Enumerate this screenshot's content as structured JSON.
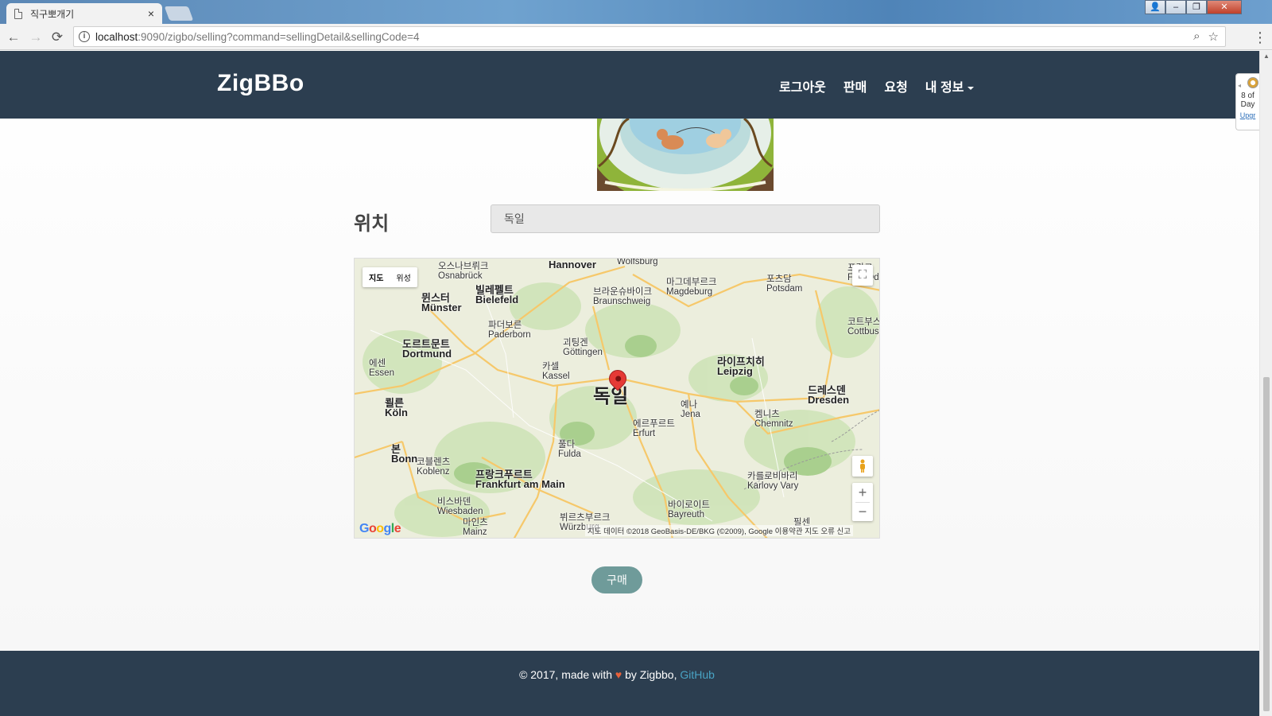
{
  "browser": {
    "tab_title": "직구뽀개기",
    "tab_close": "×",
    "url_host": "localhost",
    "url_rest": ":9090/zigbo/selling?command=sellingDetail&sellingCode=4",
    "back_icon": "←",
    "forward_icon": "→",
    "reload_icon": "⟳",
    "info_icon": "i",
    "zoom_icon": "⌕",
    "star_icon": "☆",
    "menu_icon": "⋮",
    "win_minimize": "–",
    "win_restore": "❐",
    "win_close": "✕",
    "win_user": "👤"
  },
  "extension": {
    "line1": "8 of",
    "line2": "Day",
    "link": "Upgr"
  },
  "navbar": {
    "brand": "ZigBBo",
    "links": [
      "로그아웃",
      "판매",
      "요청",
      "내 정보"
    ]
  },
  "location": {
    "label": "위치",
    "value": "독일"
  },
  "map": {
    "type_map": "지도",
    "type_satellite": "위성",
    "country_label": "독일",
    "zoom_in": "+",
    "zoom_out": "−",
    "fullscreen_icon": "⛶",
    "attribution": "지도 데이터 ©2018 GeoBasis-DE/BKG (©2009), Google   이용약관   지도 오류 신고",
    "google": "Google",
    "cities": [
      {
        "ko": "오스나브뤼크",
        "en": "Osnabrück"
      },
      {
        "ko": "",
        "en": "Hannover"
      },
      {
        "ko": "",
        "en": "Wolfsburg"
      },
      {
        "ko": "마그데부르크",
        "en": "Magdeburg"
      },
      {
        "ko": "포츠담",
        "en": "Potsdam"
      },
      {
        "ko": "프랑크",
        "en": "Fra (Oder)"
      },
      {
        "ko": "뮌스터",
        "en": "Münster"
      },
      {
        "ko": "빌레펠트",
        "en": "Bielefeld"
      },
      {
        "ko": "브라운슈바이크",
        "en": "Braunschweig"
      },
      {
        "ko": "파더보른",
        "en": "Paderborn"
      },
      {
        "ko": "코트부스",
        "en": "Cottbus"
      },
      {
        "ko": "도르트문트",
        "en": "Dortmund"
      },
      {
        "ko": "괴팅겐",
        "en": "Göttingen"
      },
      {
        "ko": "라이프치히",
        "en": "Leipzig"
      },
      {
        "ko": "에센",
        "en": "Essen"
      },
      {
        "ko": "카셀",
        "en": "Kassel"
      },
      {
        "ko": "드레스덴",
        "en": "Dresden"
      },
      {
        "ko": "쾰른",
        "en": "Köln"
      },
      {
        "ko": "예나",
        "en": "Jena"
      },
      {
        "ko": "에르푸르트",
        "en": "Erfurt"
      },
      {
        "ko": "켐니츠",
        "en": "Chemnitz"
      },
      {
        "ko": "본",
        "en": "Bonn"
      },
      {
        "ko": "코블렌츠",
        "en": "Koblenz"
      },
      {
        "ko": "풀다",
        "en": "Fulda"
      },
      {
        "ko": "프랑크푸르트",
        "en": "Frankfurt am Main"
      },
      {
        "ko": "카를로비바리",
        "en": "Karlovy Vary"
      },
      {
        "ko": "비스바덴",
        "en": "Wiesbaden"
      },
      {
        "ko": "바이로이트",
        "en": "Bayreuth"
      },
      {
        "ko": "뷔르츠부르크",
        "en": "Würzburg"
      },
      {
        "ko": "마인츠",
        "en": "Mainz"
      },
      {
        "ko": "필센",
        "en": ""
      }
    ]
  },
  "buy_button": "구매",
  "footer": {
    "prefix": "© 2017, made with ",
    "heart": "♥",
    "middle": " by Zigbbo, ",
    "link": "GitHub"
  }
}
